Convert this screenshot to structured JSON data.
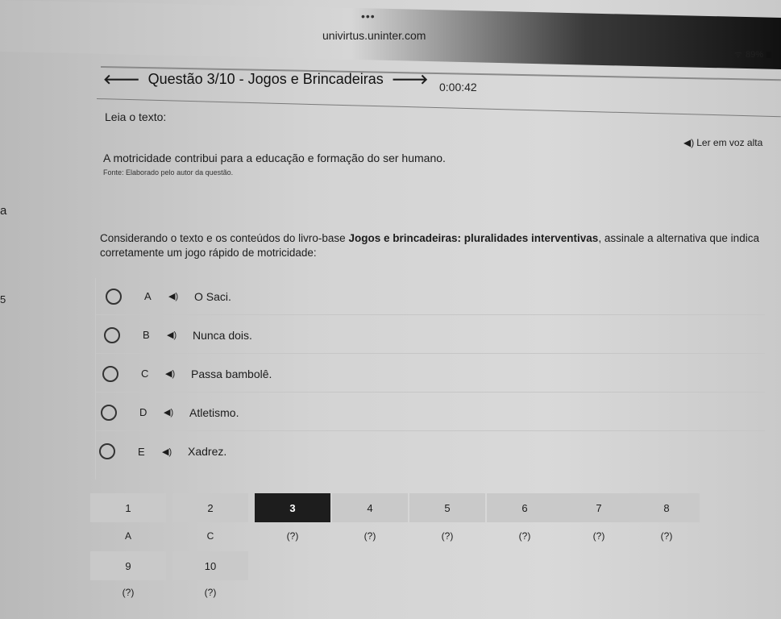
{
  "browser": {
    "dots": "•••",
    "url": "univirtus.uninter.com",
    "wifi": "ᯤ",
    "battery": "89%"
  },
  "header": {
    "title": "Questão 3/10 - Jogos e Brincadeiras",
    "timer": "0:00:42"
  },
  "content": {
    "read_label": "Leia o texto:",
    "read_aloud": "Ler em voz alta",
    "passage": "A motricidade contribui para a educação e formação do ser humano.",
    "source": "Fonte: Elaborado pelo autor da questão.",
    "edge_left_a": "a",
    "edge_left_b": "5",
    "question_start": "Considerando o texto e os conteúdos do livro-base ",
    "question_bold": "Jogos e brincadeiras: pluralidades interventivas",
    "question_end": ", assinale a alternativa que indica corretamente um jogo rápido de motricidade:"
  },
  "options": [
    {
      "letter": "A",
      "text": "O Saci."
    },
    {
      "letter": "B",
      "text": "Nunca dois."
    },
    {
      "letter": "C",
      "text": "Passa bambolê."
    },
    {
      "letter": "D",
      "text": "Atletismo."
    },
    {
      "letter": "E",
      "text": "Xadrez."
    }
  ],
  "navigation": {
    "numbers": [
      "1",
      "2",
      "3",
      "4",
      "5",
      "6",
      "7",
      "8",
      "9",
      "10"
    ],
    "answers": [
      "A",
      "C",
      "(?)",
      "(?)",
      "(?)",
      "(?)",
      "(?)",
      "(?)",
      "(?)",
      "(?)"
    ],
    "current": "3"
  }
}
